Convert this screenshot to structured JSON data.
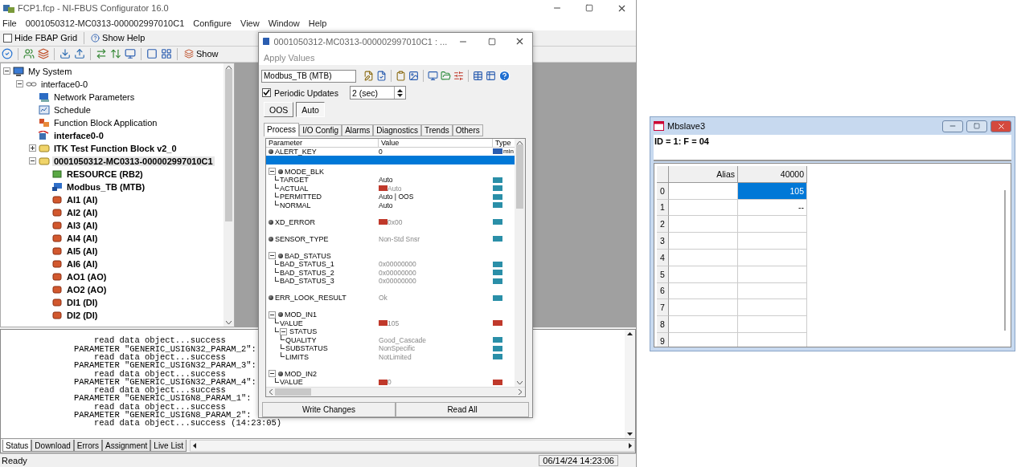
{
  "main_window": {
    "title": "FCP1.fcp - NI-FBUS Configurator 16.0",
    "menu": [
      "File",
      "0001050312-MC0313-000002997010C1",
      "Configure",
      "View",
      "Window",
      "Help"
    ],
    "toolbar": [
      {
        "kind": "checkbox",
        "label": "Hide FBAP Grid",
        "checked": false
      },
      {
        "kind": "help",
        "label": "Show Help"
      }
    ],
    "show_button": "Show",
    "tree": [
      {
        "label": "My System",
        "kind": "computer",
        "bold": false,
        "selected": false,
        "expanded": true,
        "children": [
          {
            "label": "interface0-0",
            "kind": "link",
            "bold": false,
            "selected": false,
            "expanded": true,
            "children": [
              {
                "label": "Network Parameters",
                "kind": "network",
                "bold": false,
                "selected": false
              },
              {
                "label": "Schedule",
                "kind": "schedule",
                "bold": false,
                "selected": false
              },
              {
                "label": "Function Block Application",
                "kind": "fbapp",
                "bold": false,
                "selected": false
              },
              {
                "label": "interface0-0",
                "kind": "las",
                "bold": true,
                "selected": false
              },
              {
                "label": "ITK Test Function Block v2_0",
                "kind": "device",
                "bold": true,
                "selected": false,
                "expanded": false
              },
              {
                "label": "0001050312-MC0313-000002997010C1",
                "kind": "device",
                "bold": true,
                "selected": true,
                "expanded": true,
                "children": [
                  {
                    "label": "RESOURCE (RB2)",
                    "kind": "resource",
                    "bold": true,
                    "selected": false
                  },
                  {
                    "label": "Modbus_TB (MTB)",
                    "kind": "transducer",
                    "bold": true,
                    "selected": false
                  },
                  {
                    "label": "AI1 (AI)",
                    "kind": "block",
                    "bold": true,
                    "selected": false
                  },
                  {
                    "label": "AI2 (AI)",
                    "kind": "block",
                    "bold": true,
                    "selected": false
                  },
                  {
                    "label": "AI3 (AI)",
                    "kind": "block",
                    "bold": true,
                    "selected": false
                  },
                  {
                    "label": "AI4 (AI)",
                    "kind": "block",
                    "bold": true,
                    "selected": false
                  },
                  {
                    "label": "AI5 (AI)",
                    "kind": "block",
                    "bold": true,
                    "selected": false
                  },
                  {
                    "label": "AI6 (AI)",
                    "kind": "block",
                    "bold": true,
                    "selected": false
                  },
                  {
                    "label": "AO1 (AO)",
                    "kind": "block",
                    "bold": true,
                    "selected": false
                  },
                  {
                    "label": "AO2 (AO)",
                    "kind": "block",
                    "bold": true,
                    "selected": false
                  },
                  {
                    "label": "DI1 (DI)",
                    "kind": "block",
                    "bold": true,
                    "selected": false
                  },
                  {
                    "label": "DI2 (DI)",
                    "kind": "block",
                    "bold": true,
                    "selected": false
                  }
                ]
              }
            ]
          }
        ]
      }
    ],
    "log": {
      "lines": [
        {
          "kind": "detail",
          "text": "read data object...success"
        },
        {
          "kind": "param",
          "text": "PARAMETER \"GENERIC_USIGN32_PARAM_2\":"
        },
        {
          "kind": "detail",
          "text": "read data object...success"
        },
        {
          "kind": "param",
          "text": "PARAMETER \"GENERIC_USIGN32_PARAM_3\":"
        },
        {
          "kind": "detail",
          "text": "read data object...success"
        },
        {
          "kind": "param",
          "text": "PARAMETER \"GENERIC_USIGN32_PARAM_4\":"
        },
        {
          "kind": "detail",
          "text": "read data object...success"
        },
        {
          "kind": "param",
          "text": "PARAMETER \"GENERIC_USIGN8_PARAM_1\":"
        },
        {
          "kind": "detail",
          "text": "read data object...success"
        },
        {
          "kind": "param",
          "text": "PARAMETER \"GENERIC_USIGN8_PARAM_2\":"
        },
        {
          "kind": "detail",
          "text": "read data object...success (14:23:05)"
        }
      ],
      "tabs": [
        {
          "label": "Status",
          "selected": true
        },
        {
          "label": "Download",
          "selected": false
        },
        {
          "label": "Errors",
          "selected": false
        },
        {
          "label": "Assignment",
          "selected": false
        },
        {
          "label": "Live List",
          "selected": false
        }
      ]
    },
    "status_bar": {
      "text": "Ready",
      "time": "06/14/24 14:23:06"
    }
  },
  "dialog": {
    "title": "0001050312-MC0313-000002997010C1 : ...",
    "menu": [
      {
        "label": "Apply Values",
        "disabled": true
      }
    ],
    "block_field": "Modbus_TB (MTB)",
    "periodic": {
      "label": "Periodic Updates",
      "checked": true,
      "value": "2 (sec)"
    },
    "mode_buttons": [
      {
        "label": "OOS",
        "selected": false
      },
      {
        "label": "Auto",
        "selected": true
      }
    ],
    "tabs": [
      {
        "label": "Process",
        "selected": true
      },
      {
        "label": "I/O Config",
        "selected": false
      },
      {
        "label": "Alarms",
        "selected": false
      },
      {
        "label": "Diagnostics",
        "selected": false
      },
      {
        "label": "Trends",
        "selected": false
      },
      {
        "label": "Others",
        "selected": false
      }
    ],
    "columns": [
      "Parameter",
      "Value",
      "Type"
    ],
    "params": [
      {
        "kind": "param",
        "name": "ALERT_KEY",
        "value": "0",
        "readonly": false,
        "dynamic": false,
        "color": "#2a5db0",
        "type_text": "min",
        "selected": false
      },
      {
        "kind": "blank",
        "selected": true
      },
      {
        "kind": "param",
        "name": "MODE_BLK",
        "selected": false,
        "expanded": true,
        "children": [
          {
            "kind": "param",
            "name": "TARGET",
            "value": "Auto",
            "readonly": false,
            "dynamic": false,
            "color": "#2a8fa8",
            "selected": false
          },
          {
            "kind": "param",
            "name": "ACTUAL",
            "value": "Auto",
            "readonly": true,
            "dynamic": true,
            "color": "#2a8fa8",
            "selected": false
          },
          {
            "kind": "param",
            "name": "PERMITTED",
            "value": "Auto | OOS",
            "readonly": false,
            "dynamic": false,
            "color": "#2a8fa8",
            "selected": false
          },
          {
            "kind": "param",
            "name": "NORMAL",
            "value": "Auto",
            "readonly": false,
            "dynamic": false,
            "color": "#2a8fa8",
            "selected": false
          }
        ]
      },
      {
        "kind": "param",
        "name": "XD_ERROR",
        "value": "0x00",
        "readonly": true,
        "dynamic": true,
        "color": "#2a8fa8",
        "selected": false
      },
      {
        "kind": "param",
        "name": "SENSOR_TYPE",
        "value": "Non-Std Snsr",
        "readonly": true,
        "dynamic": false,
        "color": "#2a8fa8",
        "selected": false
      },
      {
        "kind": "param",
        "name": "BAD_STATUS",
        "selected": false,
        "expanded": true,
        "children": [
          {
            "kind": "param",
            "name": "BAD_STATUS_1",
            "value": "0x00000000",
            "readonly": true,
            "dynamic": false,
            "color": "#2a8fa8",
            "selected": false
          },
          {
            "kind": "param",
            "name": "BAD_STATUS_2",
            "value": "0x00000000",
            "readonly": true,
            "dynamic": false,
            "color": "#2a8fa8",
            "selected": false
          },
          {
            "kind": "param",
            "name": "BAD_STATUS_3",
            "value": "0x00000000",
            "readonly": true,
            "dynamic": false,
            "color": "#2a8fa8",
            "selected": false
          }
        ]
      },
      {
        "kind": "param",
        "name": "ERR_LOOK_RESULT",
        "value": "Ok",
        "readonly": true,
        "dynamic": false,
        "color": "#2a8fa8",
        "selected": false
      },
      {
        "kind": "param",
        "name": "MOD_IN1",
        "selected": false,
        "expanded": true,
        "children": [
          {
            "kind": "param",
            "name": "VALUE",
            "value": "105",
            "readonly": true,
            "dynamic": true,
            "color": "#c0392b",
            "selected": false
          },
          {
            "kind": "param",
            "name": "STATUS",
            "selected": false,
            "expanded": true,
            "children": [
              {
                "kind": "param",
                "name": "QUALITY",
                "value": "Good_Cascade",
                "readonly": true,
                "dynamic": false,
                "color": "#2a8fa8",
                "selected": false
              },
              {
                "kind": "param",
                "name": "SUBSTATUS",
                "value": "NonSpecific",
                "readonly": true,
                "dynamic": false,
                "color": "#2a8fa8",
                "selected": false
              },
              {
                "kind": "param",
                "name": "LIMITS",
                "value": "NotLimited",
                "readonly": true,
                "dynamic": false,
                "color": "#2a8fa8",
                "selected": false
              }
            ]
          }
        ]
      },
      {
        "kind": "param",
        "name": "MOD_IN2",
        "selected": false,
        "expanded": true,
        "children": [
          {
            "kind": "param",
            "name": "VALUE",
            "value": "0",
            "readonly": true,
            "dynamic": true,
            "color": "#c0392b",
            "selected": false
          }
        ]
      }
    ],
    "buttons": [
      "Write Changes",
      "Read All"
    ]
  },
  "slave_window": {
    "title": "Mbslave3",
    "info": "ID = 1: F = 04",
    "columns": [
      "Alias",
      "40000"
    ],
    "rows": [
      {
        "index": "0",
        "value": "105",
        "selected": true
      },
      {
        "index": "1",
        "value": "--",
        "selected": false
      },
      {
        "index": "2",
        "selected": false
      },
      {
        "index": "3",
        "selected": false
      },
      {
        "index": "4",
        "selected": false
      },
      {
        "index": "5",
        "selected": false
      },
      {
        "index": "6",
        "selected": false
      },
      {
        "index": "7",
        "selected": false
      },
      {
        "index": "8",
        "selected": false
      },
      {
        "index": "9",
        "selected": false
      }
    ]
  }
}
